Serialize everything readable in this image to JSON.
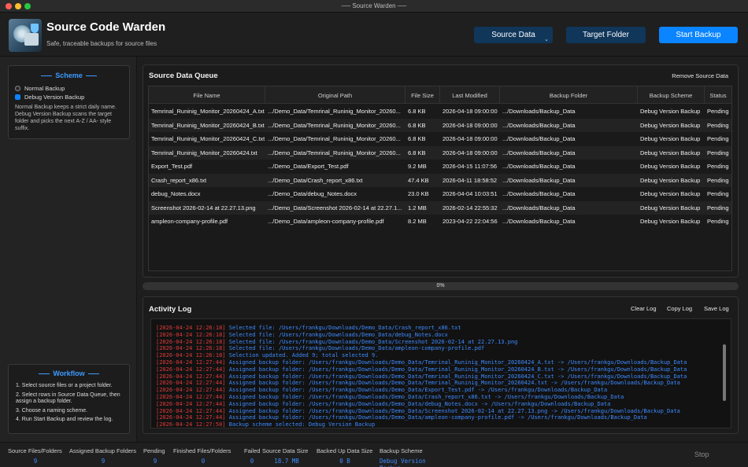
{
  "window": {
    "title": "Source Warden"
  },
  "header": {
    "app_title": "Source Code Warden",
    "subtitle": "Safe, traceable backups for source files",
    "source_data_label": "Source Data",
    "target_folder_label": "Target Folder",
    "start_backup_label": "Start Backup",
    "accent_color": "#0a84ff"
  },
  "scheme": {
    "heading": "Scheme",
    "options": [
      {
        "label": "Normal Backup",
        "selected": false
      },
      {
        "label": "Debug Version Backup",
        "selected": true
      }
    ],
    "description": "Normal Backup keeps a strict daily name. Debug Version Backup scans the target folder and picks the next A-Z / AA- style suffix."
  },
  "workflow": {
    "heading": "Workflow",
    "steps": [
      "1. Select source files or a project folder.",
      "2. Select rows in Source Data Queue, then assign a backup folder.",
      "3. Choose a naming scheme.",
      "4. Run Start Backup and review the log."
    ]
  },
  "queue": {
    "title": "Source Data Queue",
    "remove_label": "Remove Source Data",
    "columns": [
      "File Name",
      "Original Path",
      "File Size",
      "Last Modified",
      "Backup Folder",
      "Backup Scheme",
      "Status"
    ],
    "rows": [
      [
        "Temrinal_Runinig_Monitor_20260424_A.txt",
        ".../Demo_Data/Temrinal_Runinig_Monitor_20260...",
        "6.8 KB",
        "2026-04-18 09:00:00",
        ".../Downloads/Backup_Data",
        "Debug Version Backup",
        "Pending"
      ],
      [
        "Temrinal_Runinig_Monitor_20260424_B.txt",
        ".../Demo_Data/Temrinal_Runinig_Monitor_20260...",
        "6.8 KB",
        "2026-04-18 09:00:00",
        ".../Downloads/Backup_Data",
        "Debug Version Backup",
        "Pending"
      ],
      [
        "Temrinal_Runinig_Monitor_20260424_C.txt",
        ".../Demo_Data/Temrinal_Runinig_Monitor_20260...",
        "6.8 KB",
        "2026-04-18 09:00:00",
        ".../Downloads/Backup_Data",
        "Debug Version Backup",
        "Pending"
      ],
      [
        "Temrinal_Runinig_Monitor_20260424.txt",
        ".../Demo_Data/Temrinal_Runinig_Monitor_20260...",
        "6.8 KB",
        "2026-04-18 09:00:00",
        ".../Downloads/Backup_Data",
        "Debug Version Backup",
        "Pending"
      ],
      [
        "Export_Test.pdf",
        ".../Demo_Data/Export_Test.pdf",
        "9.2 MB",
        "2026-04-15 11:07:56",
        ".../Downloads/Backup_Data",
        "Debug Version Backup",
        "Pending"
      ],
      [
        "Crash_report_x86.txt",
        ".../Demo_Data/Crash_report_x86.txt",
        "47.4 KB",
        "2026-04-11 18:58:52",
        ".../Downloads/Backup_Data",
        "Debug Version Backup",
        "Pending"
      ],
      [
        "debug_Notes.docx",
        ".../Demo_Data/debug_Notes.docx",
        "23.0 KB",
        "2026-04-04 10:03:51",
        ".../Downloads/Backup_Data",
        "Debug Version Backup",
        "Pending"
      ],
      [
        "Screenshot 2026-02-14 at 22.27.13.png",
        ".../Demo_Data/Screenshot 2026-02-14 at 22.27.1...",
        "1.2 MB",
        "2026-02-14 22:55:32",
        ".../Downloads/Backup_Data",
        "Debug Version Backup",
        "Pending"
      ],
      [
        "ampleon-company-profile.pdf",
        ".../Demo_Data/ampleon-company-profile.pdf",
        "8.2 MB",
        "2023-04-22 22:04:56",
        ".../Downloads/Backup_Data",
        "Debug Version Backup",
        "Pending"
      ]
    ]
  },
  "progress": {
    "text": "0%",
    "value": 0
  },
  "log": {
    "title": "Activity Log",
    "clear_label": "Clear Log",
    "copy_label": "Copy Log",
    "save_label": "Save Log",
    "entries": [
      {
        "ts": "[2026-04-24 12:26:18]",
        "msg": "Selected file: /Users/frankgu/Downloads/Demo_Data/Crash_report_x86.txt"
      },
      {
        "ts": "[2026-04-24 12:26:18]",
        "msg": "Selected file: /Users/frankgu/Downloads/Demo_Data/debug_Notes.docx"
      },
      {
        "ts": "[2026-04-24 12:26:18]",
        "msg": "Selected file: /Users/frankgu/Downloads/Demo_Data/Screenshot 2026-02-14 at 22.27.13.png"
      },
      {
        "ts": "[2026-04-24 12:26:18]",
        "msg": "Selected file: /Users/frankgu/Downloads/Demo_Data/ampleon-company-profile.pdf"
      },
      {
        "ts": "[2026-04-24 12:26:18]",
        "msg": "Selection updated. Added 9; total selected 9."
      },
      {
        "ts": "[2026-04-24 12:27:44]",
        "msg": "Assigned backup folder: /Users/frankgu/Downloads/Demo_Data/Temrinal_Runinig_Monitor_20260424_A.txt -> /Users/frankgu/Downloads/Backup_Data"
      },
      {
        "ts": "[2026-04-24 12:27:44]",
        "msg": "Assigned backup folder: /Users/frankgu/Downloads/Demo_Data/Temrinal_Runinig_Monitor_20260424_B.txt -> /Users/frankgu/Downloads/Backup_Data"
      },
      {
        "ts": "[2026-04-24 12:27:44]",
        "msg": "Assigned backup folder: /Users/frankgu/Downloads/Demo_Data/Temrinal_Runinig_Monitor_20260424_C.txt -> /Users/frankgu/Downloads/Backup_Data"
      },
      {
        "ts": "[2026-04-24 12:27:44]",
        "msg": "Assigned backup folder: /Users/frankgu/Downloads/Demo_Data/Temrinal_Runinig_Monitor_20260424.txt -> /Users/frankgu/Downloads/Backup_Data"
      },
      {
        "ts": "[2026-04-24 12:27:44]",
        "msg": "Assigned backup folder: /Users/frankgu/Downloads/Demo_Data/Export_Test.pdf -> /Users/frankgu/Downloads/Backup_Data"
      },
      {
        "ts": "[2026-04-24 12:27:44]",
        "msg": "Assigned backup folder: /Users/frankgu/Downloads/Demo_Data/Crash_report_x86.txt -> /Users/frankgu/Downloads/Backup_Data"
      },
      {
        "ts": "[2026-04-24 12:27:44]",
        "msg": "Assigned backup folder: /Users/frankgu/Downloads/Demo_Data/debug_Notes.docx -> /Users/frankgu/Downloads/Backup_Data"
      },
      {
        "ts": "[2026-04-24 12:27:44]",
        "msg": "Assigned backup folder: /Users/frankgu/Downloads/Demo_Data/Screenshot 2026-02-14 at 22.27.13.png -> /Users/frankgu/Downloads/Backup_Data"
      },
      {
        "ts": "[2026-04-24 12:27:44]",
        "msg": "Assigned backup folder: /Users/frankgu/Downloads/Demo_Data/ampleon-company-profile.pdf -> /Users/frankgu/Downloads/Backup_Data"
      },
      {
        "ts": "[2026-04-24 12:27:50]",
        "msg": "Backup scheme selected: Debug Version Backup"
      }
    ]
  },
  "status": {
    "items": [
      {
        "label": "Source Files/Folders",
        "value": "9"
      },
      {
        "label": "Assigned Backup Folders",
        "value": "9"
      },
      {
        "label": "Pending",
        "value": "9"
      },
      {
        "label": "Finished Files/Folders",
        "value": "0"
      },
      {
        "label": "Failed",
        "value": "0"
      },
      {
        "label": "Source Data Size",
        "value": "18.7 MB"
      },
      {
        "label": "Backed Up Data Size",
        "value": "0 B"
      },
      {
        "label": "Backup Scheme",
        "value": "Debug Version Backup"
      }
    ],
    "stop_label": "Stop"
  }
}
